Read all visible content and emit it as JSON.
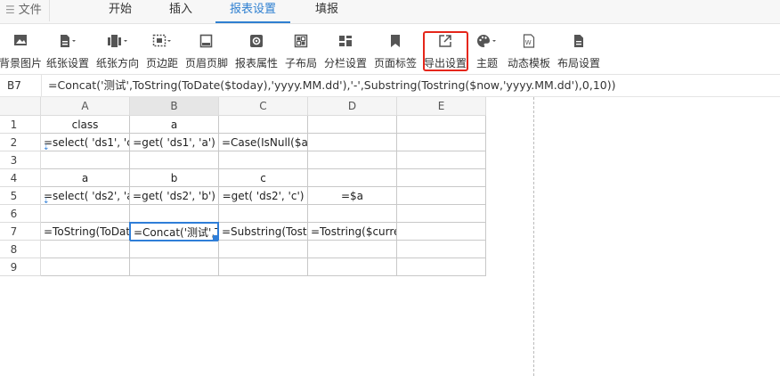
{
  "menubar": {
    "file_label": "文件",
    "tabs": [
      {
        "label": "开始"
      },
      {
        "label": "插入"
      },
      {
        "label": "报表设置",
        "active": true
      },
      {
        "label": "填报"
      }
    ]
  },
  "toolbar": {
    "items": [
      {
        "label": "背景图片",
        "icon": "image-icon"
      },
      {
        "label": "纸张设置",
        "icon": "paper-icon"
      },
      {
        "label": "纸张方向",
        "icon": "orientation-icon"
      },
      {
        "label": "页边距",
        "icon": "margin-icon"
      },
      {
        "label": "页眉页脚",
        "icon": "header-footer-icon"
      },
      {
        "label": "报表属性",
        "icon": "gear-icon"
      },
      {
        "label": "子布局",
        "icon": "sub-layout-icon"
      },
      {
        "label": "分栏设置",
        "icon": "columns-icon"
      },
      {
        "label": "页面标签",
        "icon": "bookmark-icon"
      },
      {
        "label": "导出设置",
        "icon": "export-icon",
        "highlighted": true
      },
      {
        "label": "主题",
        "icon": "palette-icon"
      },
      {
        "label": "动态模板",
        "icon": "word-template-icon"
      },
      {
        "label": "布局设置",
        "icon": "document-icon"
      }
    ],
    "highlight_color": "#e5261a"
  },
  "formula_bar": {
    "cell_ref": "B7",
    "formula": "=Concat('测试',ToString(ToDate($today),'yyyy.MM.dd'),'-',Substring(Tostring($now,'yyyy.MM.dd'),0,10))"
  },
  "sheet": {
    "columns": [
      "A",
      "B",
      "C",
      "D",
      "E"
    ],
    "rows": [
      "1",
      "2",
      "3",
      "4",
      "5",
      "6",
      "7",
      "8",
      "9"
    ],
    "cells": {
      "r1": [
        "class",
        "a",
        "",
        "",
        ""
      ],
      "r2": [
        "=select( 'ds1', 'cl",
        "=get( 'ds1', 'a')",
        "=Case(IsNull($a)",
        "",
        ""
      ],
      "r3": [
        "",
        "",
        "",
        "",
        ""
      ],
      "r4": [
        "a",
        "b",
        "c",
        "",
        ""
      ],
      "r5": [
        "=select( 'ds2', 'a')",
        "=get( 'ds2', 'b')",
        "=get( 'ds2', 'c')",
        "=$a",
        ""
      ],
      "r6": [
        "",
        "",
        "",
        "",
        ""
      ],
      "r7": [
        "=ToString(ToDat",
        "=Concat('测试',T",
        "=Substring(Tostri",
        "=Tostring($curre",
        ""
      ],
      "r8": [
        "",
        "",
        "",
        "",
        ""
      ],
      "r9": [
        "",
        "",
        "",
        "",
        ""
      ]
    },
    "selected_cell": "B7",
    "accent_color": "#2f7ed8"
  }
}
